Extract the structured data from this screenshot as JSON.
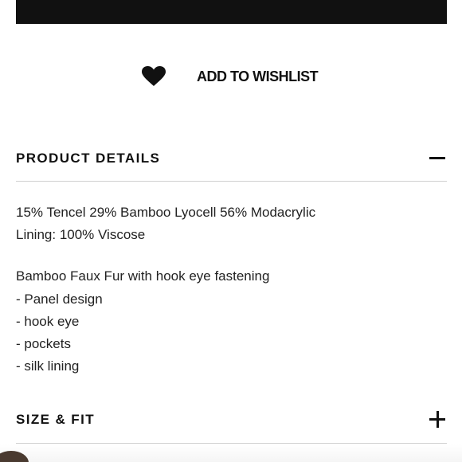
{
  "wishlist": {
    "label": "ADD TO WISHLIST",
    "icon": "heart-icon"
  },
  "sections": [
    {
      "title": "PRODUCT DETAILS",
      "expanded": true,
      "toggle_icon": "minus-icon"
    },
    {
      "title": "SIZE & FIT",
      "expanded": false,
      "toggle_icon": "plus-icon"
    }
  ],
  "product_details": {
    "composition": [
      "15% Tencel 29% Bamboo Lyocell 56% Modacrylic",
      "Lining: 100% Viscose"
    ],
    "description": "Bamboo Faux Fur with hook eye fastening",
    "features": [
      "- Panel design",
      "- hook eye",
      "- pockets",
      "- silk lining"
    ]
  },
  "colors": {
    "text": "#1a1a1a",
    "divider": "#cfcfcf",
    "bar": "#111111"
  }
}
